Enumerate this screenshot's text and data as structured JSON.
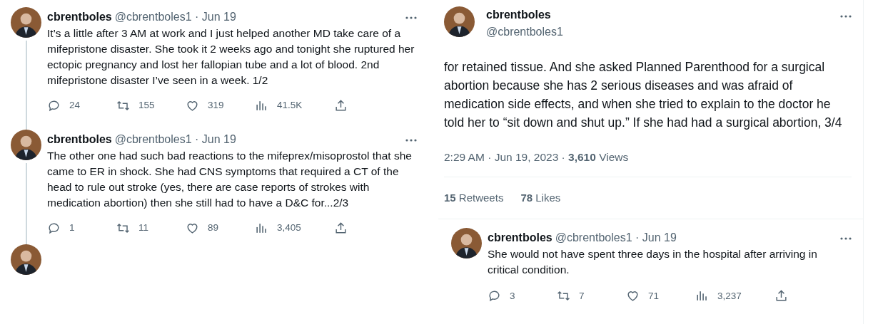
{
  "thread": [
    {
      "name": "cbrentboles",
      "meta": "@cbrentboles1 · Jun 19",
      "text": "It’s a little after 3 AM at work and I just helped another MD take care of a mifepristone disaster. She took it 2 weeks ago and tonight she ruptured her ectopic pregnancy and lost her fallopian tube and a lot of blood. 2nd mifepristone disaster I’ve seen in a week. 1/2",
      "replies": "24",
      "retweets": "155",
      "likes": "319",
      "views": "41.5K"
    },
    {
      "name": "cbrentboles",
      "meta": "@cbrentboles1 · Jun 19",
      "text": "The other one had such bad reactions to the mifeprex/misoprostol that she came to ER in shock. She had CNS symptoms that required a CT of the head to rule out stroke (yes, there are case reports of strokes with medication abortion) then she still had to have a D&C for...2/3",
      "replies": "1",
      "retweets": "11",
      "likes": "89",
      "views": "3,405"
    }
  ],
  "focused_tweet": {
    "name": "cbrentboles",
    "handle": "@cbrentboles1",
    "text": "for retained tissue. And she asked Planned Parenthood for a surgical abortion because she has 2 serious diseases and was afraid of medication side effects, and when she tried to explain to the doctor he told her to “sit down and shut up.” If she had had a surgical abortion, 3/4",
    "timestamp": "2:29 AM · Jun 19, 2023 · **3,610** Views",
    "retweets": "**15** Retweets",
    "likes": "**78** Likes"
  },
  "reply": {
    "name": "cbrentboles",
    "meta": "@cbrentboles1 · Jun 19",
    "text": "She would not have spent three days in the hospital after arriving in critical condition.",
    "replies": "3",
    "retweets": "7",
    "likes": "71",
    "views": "3,237"
  }
}
